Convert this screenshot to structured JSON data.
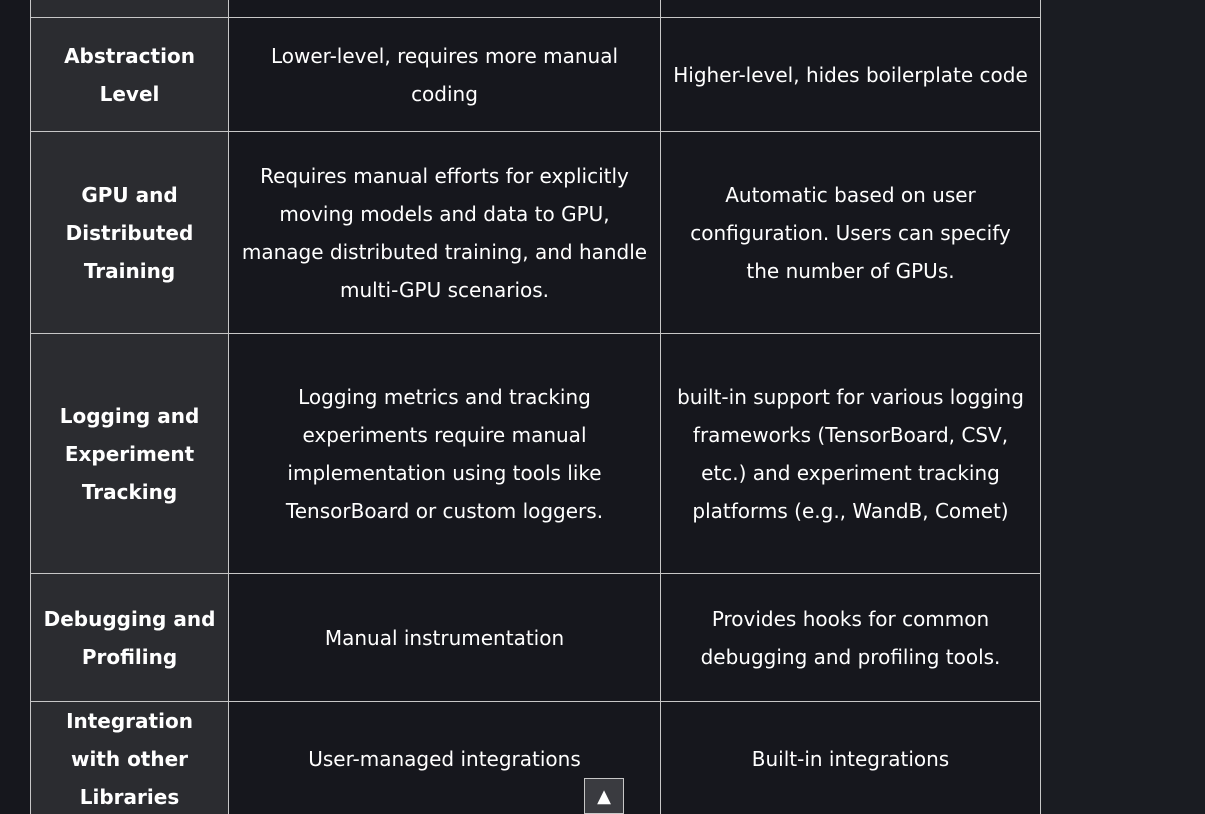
{
  "table": {
    "rows": [
      {
        "id": "abstraction-level",
        "label": "Abstraction Level",
        "pytorch": "Lower-level, requires more manual coding",
        "lightning": "Higher-level, hides boilerplate code"
      },
      {
        "id": "gpu-distributed-training",
        "label": "GPU and Distributed Training",
        "pytorch": "Requires manual efforts for explicitly moving models and data to GPU, manage distributed training, and handle multi-GPU scenarios.",
        "lightning": "Automatic based on user configuration. Users can specify the number of GPUs."
      },
      {
        "id": "logging-experiment-tracking",
        "label": "Logging and Experiment Tracking",
        "pytorch": "Logging metrics and tracking experiments require manual implementation using tools like TensorBoard or custom loggers.",
        "lightning": "built-in support for various logging frameworks (TensorBoard, CSV, etc.) and experiment tracking platforms (e.g., WandB, Comet)"
      },
      {
        "id": "debugging-profiling",
        "label": "Debugging and Profiling",
        "pytorch": "Manual instrumentation",
        "lightning": "Provides hooks for common debugging and profiling tools."
      },
      {
        "id": "integration-other-libraries",
        "label": "Integration with other Libraries",
        "pytorch": "User-managed integrations",
        "lightning": "Built-in integrations"
      }
    ]
  },
  "scroll_top": {
    "icon": "up-arrow-icon",
    "glyph": "▲"
  }
}
